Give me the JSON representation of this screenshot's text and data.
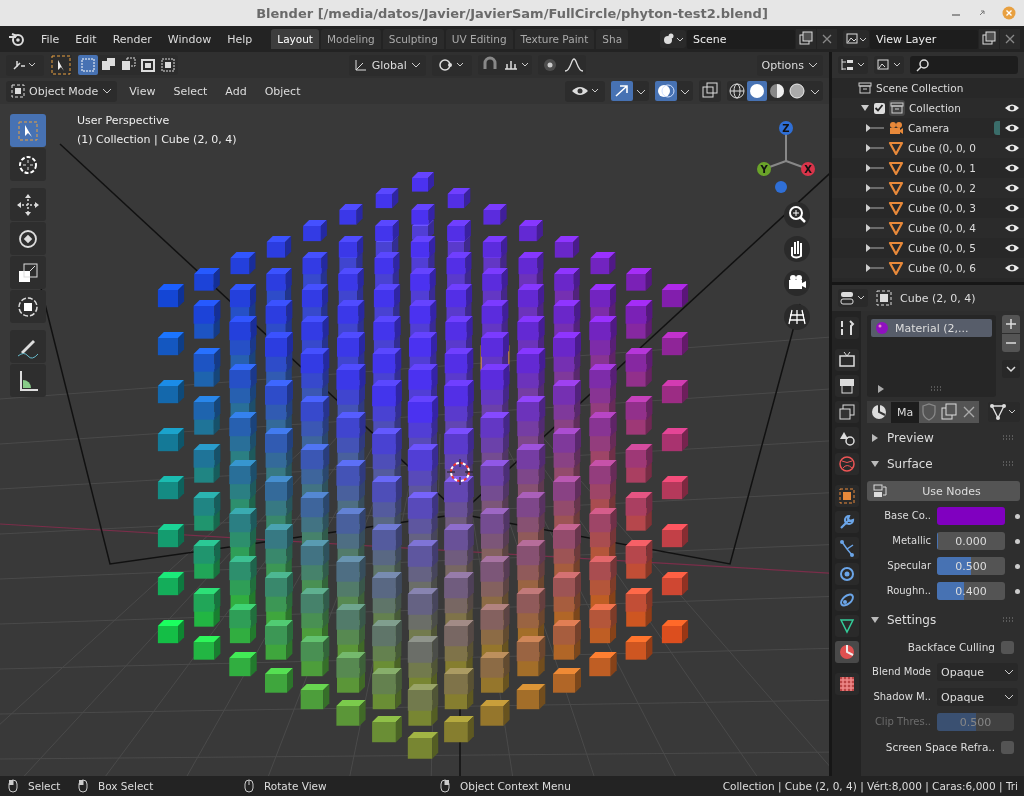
{
  "window": {
    "title": "Blender [/media/datos/Javier/JavierSam/FullCircle/phyton-test2.blend]"
  },
  "menu": [
    "File",
    "Edit",
    "Render",
    "Window",
    "Help"
  ],
  "workspace_tabs": [
    {
      "label": "Layout",
      "selected": true
    },
    {
      "label": "Modeling",
      "selected": false
    },
    {
      "label": "Sculpting",
      "selected": false
    },
    {
      "label": "UV Editing",
      "selected": false
    },
    {
      "label": "Texture Paint",
      "selected": false
    },
    {
      "label": "Sha",
      "selected": false
    }
  ],
  "scene": "Scene",
  "view_layer": "View Layer",
  "tool_header": {
    "orientation": "Global",
    "options": "Options"
  },
  "viewport_header": {
    "mode": "Object Mode",
    "menus": [
      "View",
      "Select",
      "Add",
      "Object"
    ]
  },
  "viewport": {
    "view_name": "User Perspective",
    "active_object": "(1) Collection | Cube (2, 0, 4)",
    "axes": [
      {
        "label": "Z",
        "color": "#2f6fd6"
      },
      {
        "label": "Y",
        "color": "#6aa329"
      },
      {
        "label": "X",
        "color": "#d9344a"
      }
    ],
    "tools": [
      {
        "kind": "select",
        "selected": true
      },
      {
        "kind": "cursor",
        "selected": false
      },
      {
        "kind": "move",
        "selected": false
      },
      {
        "kind": "rotate",
        "selected": false
      },
      {
        "kind": "scale",
        "selected": false
      },
      {
        "kind": "transform",
        "selected": false
      },
      {
        "kind": "annotate",
        "selected": false
      },
      {
        "kind": "measure",
        "selected": false
      }
    ]
  },
  "outliner": {
    "root": "Scene Collection",
    "items": [
      {
        "label": "Collection",
        "kind": "collection",
        "checked": true,
        "expanded": true,
        "children": [
          {
            "label": "Camera",
            "kind": "camera",
            "expanded": false
          },
          {
            "label": "Cube (0, 0, 0",
            "kind": "mesh",
            "expanded": false
          },
          {
            "label": "Cube (0, 0, 1",
            "kind": "mesh",
            "expanded": false
          },
          {
            "label": "Cube (0, 0, 2",
            "kind": "mesh",
            "expanded": false
          },
          {
            "label": "Cube (0, 0, 3",
            "kind": "mesh",
            "expanded": false
          },
          {
            "label": "Cube (0, 0, 4",
            "kind": "mesh",
            "expanded": false
          },
          {
            "label": "Cube (0, 0, 5",
            "kind": "mesh",
            "expanded": false
          },
          {
            "label": "Cube (0, 0, 6",
            "kind": "mesh",
            "expanded": false
          }
        ]
      }
    ]
  },
  "properties": {
    "object": "Cube (2, 0, 4)",
    "tabs": [
      {
        "kind": "tool",
        "selected": false
      },
      {
        "kind": "render",
        "selected": false
      },
      {
        "kind": "output",
        "selected": false
      },
      {
        "kind": "view_layer",
        "selected": false
      },
      {
        "kind": "scene",
        "selected": false
      },
      {
        "kind": "world",
        "selected": false
      },
      {
        "kind": "object",
        "selected": false
      },
      {
        "kind": "modifier",
        "selected": false
      },
      {
        "kind": "particles",
        "selected": false
      },
      {
        "kind": "physics",
        "selected": false
      },
      {
        "kind": "constraints",
        "selected": false
      },
      {
        "kind": "data",
        "selected": false
      },
      {
        "kind": "material",
        "selected": true
      },
      {
        "kind": "texture",
        "selected": false
      }
    ],
    "material_slots": [
      {
        "label": "Material (2,...",
        "selected": true
      }
    ],
    "material_name": "Ma",
    "panels": [
      {
        "title": "Preview",
        "expanded": false
      },
      {
        "title": "Surface",
        "expanded": true,
        "rows": [
          {
            "kind": "button",
            "label": "Use Nodes"
          },
          {
            "kind": "color",
            "label": "Base Co..",
            "color": "#8000c0"
          },
          {
            "kind": "slider",
            "label": "Metallic",
            "value": "0.000",
            "level": 0,
            "disabled": false
          },
          {
            "kind": "slider",
            "label": "Specular",
            "value": "0.500",
            "level": 0.5,
            "disabled": false
          },
          {
            "kind": "slider",
            "label": "Roughn..",
            "value": "0.400",
            "level": 0.4,
            "disabled": false
          }
        ]
      },
      {
        "title": "Settings",
        "expanded": true,
        "rows": [
          {
            "kind": "checkbox",
            "label": "Backface Culling",
            "checked": false
          },
          {
            "kind": "dropdown",
            "label": "Blend Mode",
            "value": "Opaque"
          },
          {
            "kind": "dropdown",
            "label": "Shadow M..",
            "value": "Opaque"
          },
          {
            "kind": "slider",
            "label": "Clip Thres..",
            "value": "0.500",
            "level": 0.5,
            "disabled": true
          },
          {
            "kind": "checkbox",
            "label": "Screen Space Refra..",
            "checked": false
          }
        ]
      }
    ]
  },
  "status_bar": {
    "hints": [
      "Select",
      "Box Select",
      "Rotate View",
      "Object Context Menu"
    ],
    "info": "Collection | Cube (2, 0, 4) | Vért:8,000 | Caras:6,000 | Tri"
  }
}
